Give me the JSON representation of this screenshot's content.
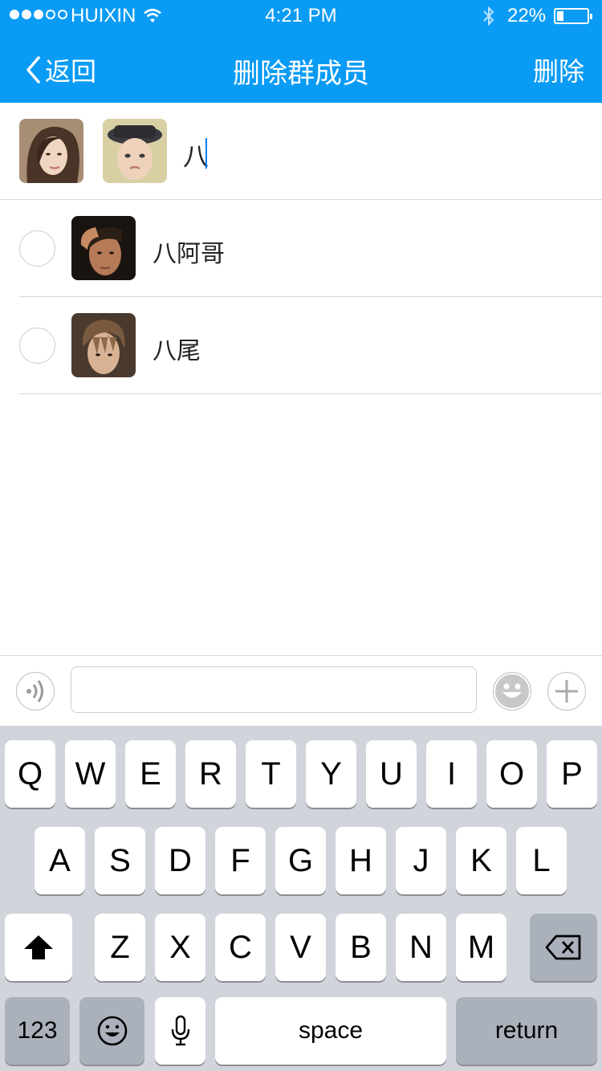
{
  "status_bar": {
    "carrier": "HUIXIN",
    "time": "4:21 PM",
    "battery_pct": "22%",
    "battery_level": 0.22
  },
  "nav": {
    "back_label": "返回",
    "title": "删除群成员",
    "action_label": "删除"
  },
  "selected": {
    "search_text": "八"
  },
  "members": [
    {
      "name": "八阿哥"
    },
    {
      "name": "八尾"
    }
  ],
  "colors": {
    "accent": "#0a9bf5",
    "caret": "#0a7cf5",
    "keyboard_bg": "#d1d5db"
  },
  "keyboard": {
    "row1": [
      "Q",
      "W",
      "E",
      "R",
      "T",
      "Y",
      "U",
      "I",
      "O",
      "P"
    ],
    "row2": [
      "A",
      "S",
      "D",
      "F",
      "G",
      "H",
      "J",
      "K",
      "L"
    ],
    "row3": [
      "Z",
      "X",
      "C",
      "V",
      "B",
      "N",
      "M"
    ],
    "numbers_label": "123",
    "space_label": "space",
    "return_label": "return"
  }
}
